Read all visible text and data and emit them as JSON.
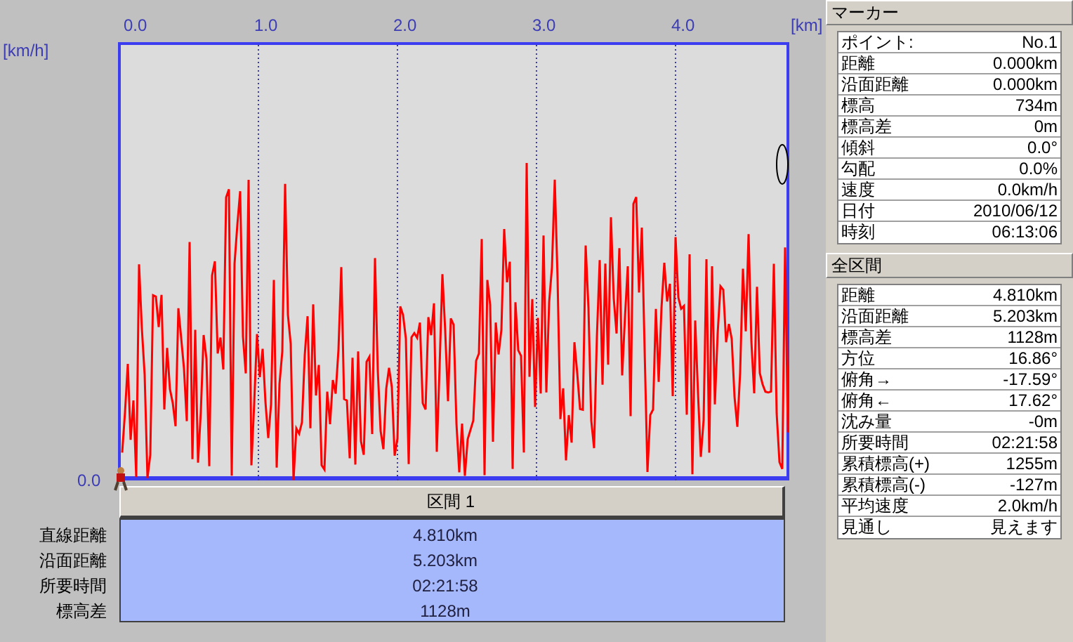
{
  "chart": {
    "y_unit": "[km/h]",
    "x_unit": "[km]",
    "x_ticks": [
      "0.0",
      "1.0",
      "2.0",
      "3.0",
      "4.0"
    ],
    "y_zero": "0.0"
  },
  "section": {
    "header": "区間 1",
    "rows": [
      {
        "label": "直線距離",
        "value": "4.810km"
      },
      {
        "label": "沿面距離",
        "value": "5.203km"
      },
      {
        "label": "所要時間",
        "value": "02:21:58"
      },
      {
        "label": "標高差",
        "value": "1128m"
      }
    ]
  },
  "marker_panel": {
    "title": "マーカー",
    "rows": [
      {
        "label": "ポイント:",
        "value": "No.1"
      },
      {
        "label": "距離",
        "value": "0.000km"
      },
      {
        "label": "沿面距離",
        "value": "0.000km"
      },
      {
        "label": "標高",
        "value": "734m"
      },
      {
        "label": "標高差",
        "value": "0m"
      },
      {
        "label": "傾斜",
        "value": "0.0°"
      },
      {
        "label": "勾配",
        "value": "0.0%"
      },
      {
        "label": "速度",
        "value": "0.0km/h"
      },
      {
        "label": "日付",
        "value": "2010/06/12"
      },
      {
        "label": "時刻",
        "value": "06:13:06"
      }
    ]
  },
  "total_panel": {
    "title": "全区間",
    "rows": [
      {
        "label": "距離",
        "value": "4.810km"
      },
      {
        "label": "沿面距離",
        "value": "5.203km"
      },
      {
        "label": "標高差",
        "value": "1128m"
      },
      {
        "label": "方位",
        "value": "16.86°"
      },
      {
        "label": "俯角→",
        "value": "-17.59°"
      },
      {
        "label": "俯角←",
        "value": "17.62°"
      },
      {
        "label": "沈み量",
        "value": "-0m"
      },
      {
        "label": "所要時間",
        "value": "02:21:58"
      },
      {
        "label": "累積標高(+)",
        "value": "1255m"
      },
      {
        "label": "累積標高(-)",
        "value": "-127m"
      },
      {
        "label": "平均速度",
        "value": "2.0km/h"
      },
      {
        "label": "見通し",
        "value": "見えます"
      }
    ]
  }
}
